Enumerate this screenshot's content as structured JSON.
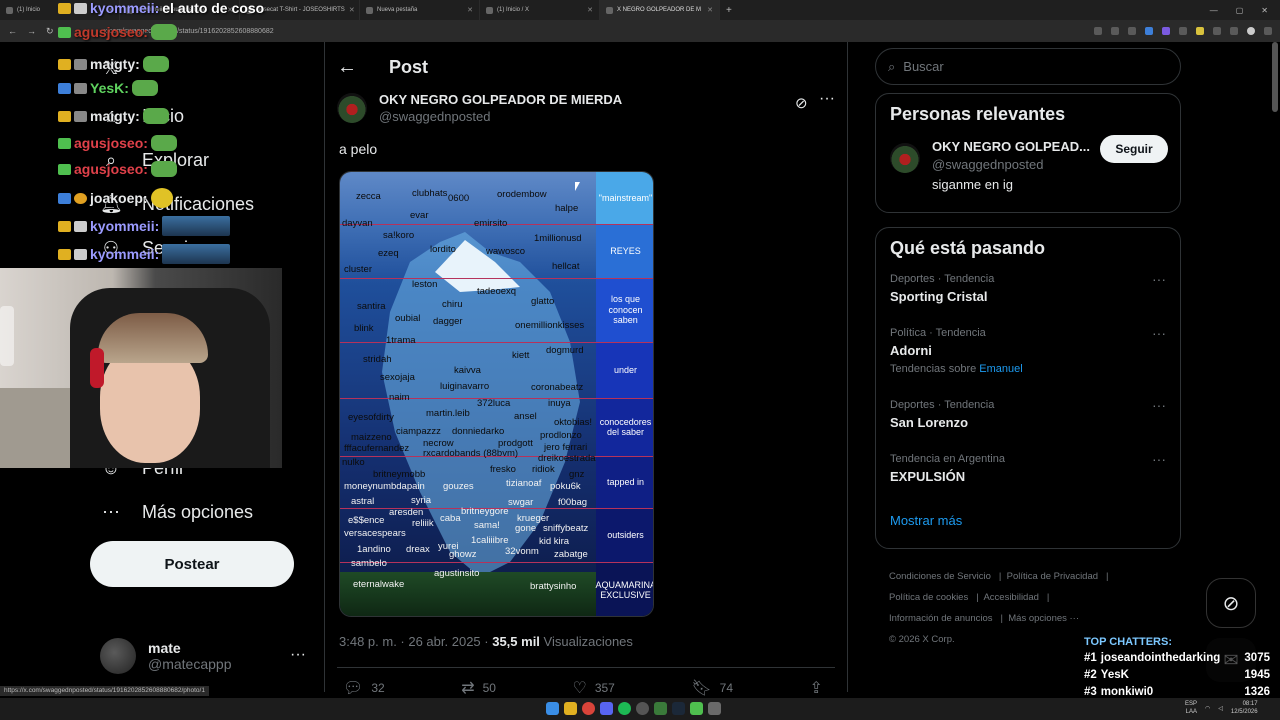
{
  "browser": {
    "tabs": [
      {
        "label": "(1) Inicio",
        "active": false
      },
      {
        "label": "kyommeii: el auto de coso",
        "active": false
      },
      {
        "label": "dosecat T-Shirt - JOSEOSHIRTS",
        "active": false
      },
      {
        "label": "Nueva pestaña",
        "active": false
      },
      {
        "label": "(1) Inicio / X",
        "active": false
      },
      {
        "label": "X NEGRO GOLPEADOR DE M",
        "active": true
      }
    ],
    "url": "x.com/swaggednposted/status/1916202852608880682",
    "status_url": "https://x.com/swaggednposted/status/1916202852608880682/photo/1"
  },
  "nav": {
    "items": [
      {
        "icon": "x-logo-icon",
        "label": ""
      },
      {
        "icon": "home-icon",
        "label": "Inicio"
      },
      {
        "icon": "search-icon",
        "label": "Explorar"
      },
      {
        "icon": "bell-icon",
        "label": "Notificaciones"
      },
      {
        "icon": "add-user-icon",
        "label": "Seguir"
      },
      {
        "icon": "profile-icon",
        "label": "Perfil"
      },
      {
        "icon": "more-icon",
        "label": "Más opciones"
      }
    ],
    "post_button": "Postear",
    "account": {
      "name": "mate",
      "handle": "@matecappp"
    }
  },
  "chat_overlay": [
    {
      "user": "kyommeii:",
      "text": "el auto de coso",
      "color": "#9b9bff"
    },
    {
      "user": "agusjoseo:",
      "text": "",
      "color": "#c0392b"
    },
    {
      "user": "maigty:",
      "text": "",
      "color": "#e7e9ea"
    },
    {
      "user": "YesK:",
      "text": "",
      "color": "#5fd35f"
    },
    {
      "user": "maigty:",
      "text": "",
      "color": "#e7e9ea"
    },
    {
      "user": "agusjoseo:",
      "text": "",
      "color": "#e0414a"
    },
    {
      "user": "agusjoseo:",
      "text": "",
      "color": "#e0414a"
    },
    {
      "user": "joakoep:",
      "text": "",
      "color": "#e7e9ea"
    },
    {
      "user": "kyommeii:",
      "text": "",
      "color": "#9b9bff"
    },
    {
      "user": "kyommeii:",
      "text": "",
      "color": "#9b9bff"
    }
  ],
  "post": {
    "header_title": "Post",
    "author_name": "OKY NEGRO GOLPEADOR DE MIERDA",
    "author_handle": "@swaggednposted",
    "text": "a pelo",
    "timestamp": "3:48 p. m. · 26 abr. 2025",
    "views_count": "35,5 mil",
    "views_label": "Visualizaciones",
    "replies": "32",
    "reposts": "50",
    "likes": "357",
    "bookmarks": "74"
  },
  "iceberg": {
    "tiers": [
      "\"mainstream\"",
      "REYES",
      "los que conocen saben",
      "under",
      "conocedores del saber",
      "tapped in",
      "outsiders",
      "AQUAMARINA EXCLUSIVE"
    ],
    "tier_colors": [
      "#4aa8e8",
      "#2a6fd6",
      "#1f4fd0",
      "#1735b8",
      "#12279c",
      "#0f1f85",
      "#0c186c",
      "#0a1456"
    ],
    "words": [
      "zecca",
      "clubhats",
      "0600",
      "orodembow",
      "halpe",
      "dayvan",
      "evar",
      "emirsito",
      "sa!koro",
      "1millionusd",
      "ezeq",
      "lordito",
      "wawosco",
      "cluster",
      "hellcat",
      "leston",
      "tadeoexq",
      "santira",
      "chiru",
      "glatto",
      "oubial",
      "blink",
      "dagger",
      "onemillionkisses",
      "1trama",
      "stridah",
      "dogmurd",
      "kiett",
      "sexojaja",
      "kaivva",
      "luiginavarro",
      "coronabeatz",
      "naim",
      "372luca",
      "inuya",
      "eyesofdirty",
      "martin.leib",
      "ansel",
      "oktobias!",
      "maizzeno",
      "ciampazzz",
      "donniedarko",
      "prodlonzo",
      "fffacufernandez",
      "necrow",
      "prodgott",
      "jero ferrari",
      "nulko",
      "rxcardobands (88bvm)",
      "dreikoestrada",
      "britneymobb",
      "fresko",
      "ridiok",
      "gnz",
      "moneynumbdapain",
      "gouzes",
      "tizianoaf",
      "poku6k",
      "astral",
      "syria",
      "swgar",
      "f00bag",
      "e$$ence",
      "aresden",
      "caba",
      "britneygore",
      "krueger",
      "versacespears",
      "reliiik",
      "sama!",
      "gone",
      "sniffybeatz",
      "1andino",
      "dreax",
      "yurei",
      "1caliiibre",
      "kid kira",
      "ghowz",
      "32vonm",
      "zabatge",
      "sambelo",
      "agustinsito",
      "eternalwake",
      "brattysinho"
    ]
  },
  "right": {
    "search_placeholder": "Buscar",
    "relevant_title": "Personas relevantes",
    "relevant_user": {
      "name": "OKY NEGRO GOLPEAD...",
      "handle": "@swaggednposted",
      "bio": "siganme en ig",
      "follow_label": "Seguir"
    },
    "trends_title": "Qué está pasando",
    "trends": [
      {
        "category": "Deportes · Tendencia",
        "name": "Sporting Cristal",
        "sub_prefix": "",
        "sub_link": ""
      },
      {
        "category": "Política · Tendencia",
        "name": "Adorni",
        "sub_prefix": "Tendencias sobre",
        "sub_link": "Emanuel"
      },
      {
        "category": "Deportes · Tendencia",
        "name": "San Lorenzo",
        "sub_prefix": "",
        "sub_link": ""
      },
      {
        "category": "Tendencia en Argentina",
        "name": "EXPULSIÓN",
        "sub_prefix": "",
        "sub_link": ""
      }
    ],
    "show_more": "Mostrar más",
    "footer": [
      "Condiciones de Servicio",
      "Política de Privacidad",
      "Política de cookies",
      "Accesibilidad",
      "Información de anuncios",
      "Más opciones ···",
      "© 2026 X Corp."
    ]
  },
  "top_chatters": {
    "title": "TOP CHATTERS:",
    "rows": [
      {
        "rank": "#1",
        "name": "joseandointhedarking",
        "count": "3075"
      },
      {
        "rank": "#2",
        "name": "YesK",
        "count": "1945"
      },
      {
        "rank": "#3",
        "name": "monkiwi0",
        "count": "1326"
      }
    ]
  },
  "taskbar": {
    "lang": "ESP",
    "lang_sub": "LAA",
    "time": "08:17",
    "date": "12/5/2026"
  }
}
